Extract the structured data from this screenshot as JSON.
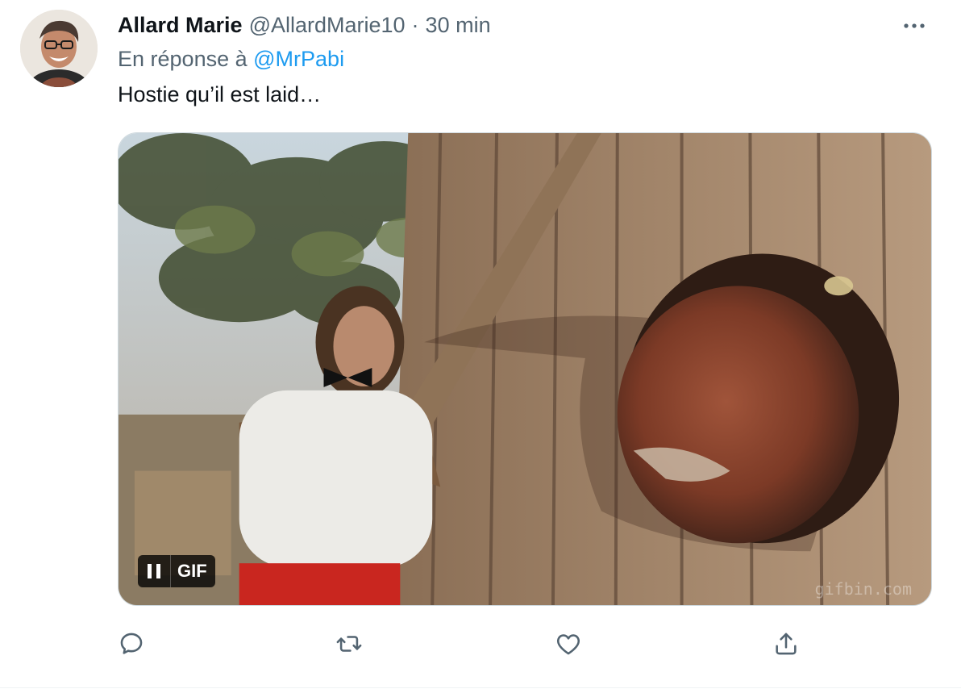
{
  "tweet": {
    "author": {
      "display_name": "Allard Marie",
      "handle": "@AllardMarie10",
      "avatar_icon": "user-avatar"
    },
    "separator": "·",
    "time": "30 min",
    "reply_prefix": "En réponse à",
    "reply_to": "@MrPabi",
    "text": "Hostie qu’il est laid…",
    "media": {
      "type": "gif",
      "badge": "GIF",
      "pause_icon": "pause-icon",
      "watermark": "gifbin.com"
    },
    "actions": {
      "reply_icon": "reply-icon",
      "retweet_icon": "retweet-icon",
      "like_icon": "heart-icon",
      "share_icon": "share-icon"
    },
    "more_icon": "more-horizontal-icon"
  },
  "colors": {
    "text_primary": "#0f1419",
    "text_secondary": "#536471",
    "accent": "#1d9bf0",
    "border": "#cfd9de"
  }
}
